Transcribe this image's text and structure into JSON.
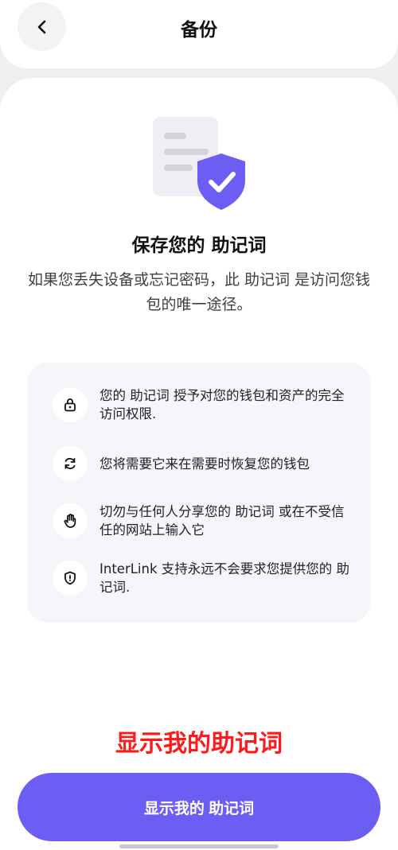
{
  "header": {
    "title": "备份"
  },
  "content": {
    "title": "保存您的 助记词",
    "subtitle": "如果您丢失设备或忘记密码，此 助记词 是访问您钱包的唯一途径。"
  },
  "tips": [
    {
      "icon": "lock-icon",
      "text": "您的 助记词 授予对您的钱包和资产的完全访问权限."
    },
    {
      "icon": "refresh-icon",
      "text": "您将需要它来在需要时恢复您的钱包"
    },
    {
      "icon": "hand-stop-icon",
      "text": "切勿与任何人分享您的 助记词 或在不受信任的网站上输入它"
    },
    {
      "icon": "shield-alert-icon",
      "text": "InterLink 支持永远不会要求您提供您的 助记词."
    }
  ],
  "highlight_label": "显示我的助记词",
  "cta": {
    "label": "显示我的 助记词"
  },
  "colors": {
    "accent": "#6c5ef3",
    "highlight": "#ff1a1a",
    "panel": "#f5f5fa"
  }
}
